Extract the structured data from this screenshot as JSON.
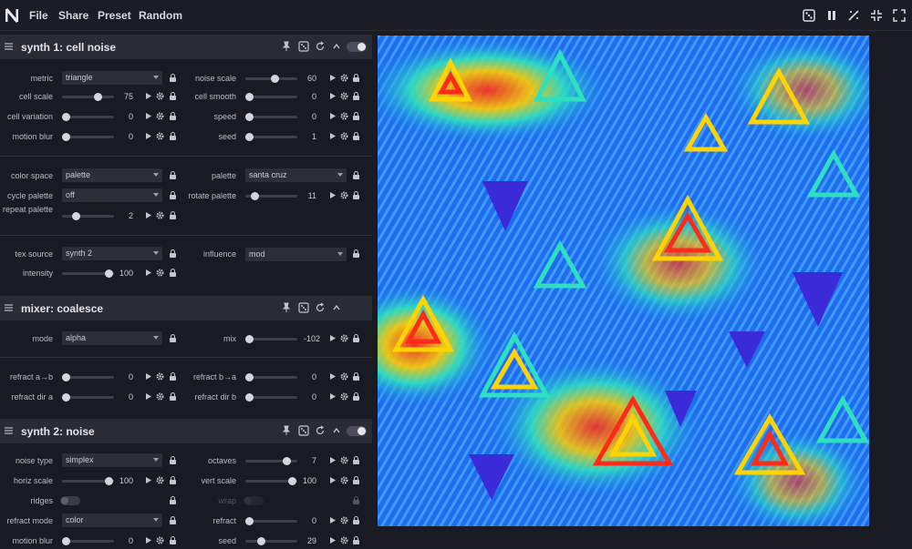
{
  "topbar": {
    "menu": [
      "File",
      "Share",
      "Preset",
      "Random"
    ],
    "icons": [
      "random-icon",
      "pause-icon",
      "wand-icon",
      "fit-icon",
      "fullscreen-icon"
    ]
  },
  "modules": [
    {
      "title": "synth 1: cell noise",
      "controls": {
        "metric": {
          "label": "metric",
          "value": "triangle"
        },
        "noise_scale": {
          "label": "noise scale",
          "value": "60"
        },
        "cell_scale": {
          "label": "cell scale",
          "value": "75"
        },
        "cell_smooth": {
          "label": "cell smooth",
          "value": "0"
        },
        "cell_variation": {
          "label": "cell variation",
          "value": "0"
        },
        "speed": {
          "label": "speed",
          "value": "0"
        },
        "motion_blur": {
          "label": "motion blur",
          "value": "0"
        },
        "seed": {
          "label": "seed",
          "value": "1"
        },
        "color_space": {
          "label": "color space",
          "value": "palette"
        },
        "palette": {
          "label": "palette",
          "value": "santa cruz"
        },
        "cycle_palette": {
          "label": "cycle palette",
          "value": "off"
        },
        "rotate_palette": {
          "label": "rotate palette",
          "value": "11"
        },
        "repeat_palette": {
          "label": "repeat palette",
          "value": "2"
        },
        "tex_source": {
          "label": "tex source",
          "value": "synth 2"
        },
        "influence": {
          "label": "influence",
          "value": "mod"
        },
        "intensity": {
          "label": "intensity",
          "value": "100"
        }
      }
    },
    {
      "title": "mixer: coalesce",
      "controls": {
        "mode": {
          "label": "mode",
          "value": "alpha"
        },
        "mix": {
          "label": "mix",
          "value": "-102"
        },
        "refract_ab": {
          "label": "refract a→b",
          "value": "0"
        },
        "refract_ba": {
          "label": "refract b→a",
          "value": "0"
        },
        "refract_dir_a": {
          "label": "refract dir a",
          "value": "0"
        },
        "refract_dir_b": {
          "label": "refract dir b",
          "value": "0"
        }
      }
    },
    {
      "title": "synth 2: noise",
      "controls": {
        "noise_type": {
          "label": "noise type",
          "value": "simplex"
        },
        "octaves": {
          "label": "octaves",
          "value": "7"
        },
        "horiz_scale": {
          "label": "horiz scale",
          "value": "100"
        },
        "vert_scale": {
          "label": "vert scale",
          "value": "100"
        },
        "ridges": {
          "label": "ridges"
        },
        "wrap": {
          "label": "wrap"
        },
        "refract_mode": {
          "label": "refract mode",
          "value": "color"
        },
        "refract": {
          "label": "refract",
          "value": "0"
        },
        "motion_blur": {
          "label": "motion blur",
          "value": "0"
        },
        "seed": {
          "label": "seed",
          "value": "29"
        }
      }
    }
  ],
  "colors": {
    "background": "#1a1b22",
    "panel_header": "#2a2c35",
    "canvas_blue": "#1e6cf0",
    "canvas_deep": "#3a2ad8"
  }
}
